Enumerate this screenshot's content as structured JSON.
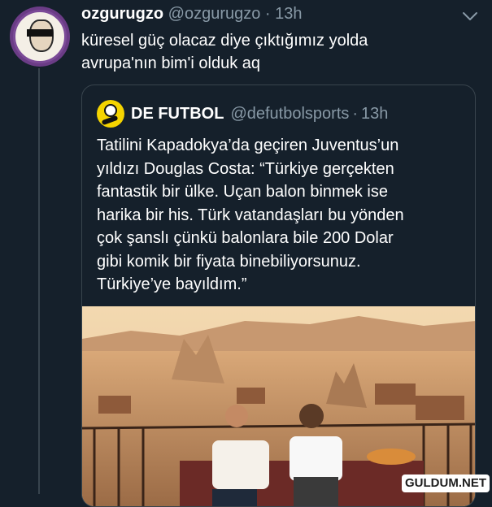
{
  "tweet": {
    "name": "ozgurugzo",
    "handle": "@ozgurugzo",
    "separator": "·",
    "time": "13h",
    "text_line1": "küresel güç olacaz diye çıktığımız yolda",
    "text_line2": "avrupa'nın bim'i olduk aq",
    "avatar_icon": "circular-seal-avatar-icon",
    "menu_icon": "chevron-down-icon"
  },
  "quote": {
    "name": "DE FUTBOL",
    "handle": "@defutbolsports",
    "separator": "·",
    "time": "13h",
    "lines": [
      "Tatilini Kapadokya’da geçiren Juventus’un",
      "yıldızı Douglas Costa: “Türkiye gerçekten",
      "fantastik bir ülke. Uçan balon binmek ise",
      "harika bir his. Türk vatandaşları bu yönden",
      "çok şanslı çünkü balonlara bile 200 Dolar",
      "gibi komik bir fiyata binebiliyorsunuz.",
      "Türkiye’ye bayıldım.”"
    ],
    "logo_icon": "soccer-ball-logo-icon"
  },
  "watermark": "GULDUM.NET",
  "colors": {
    "background": "#15202b",
    "secondary_text": "#8899a6",
    "border": "#38444d"
  }
}
